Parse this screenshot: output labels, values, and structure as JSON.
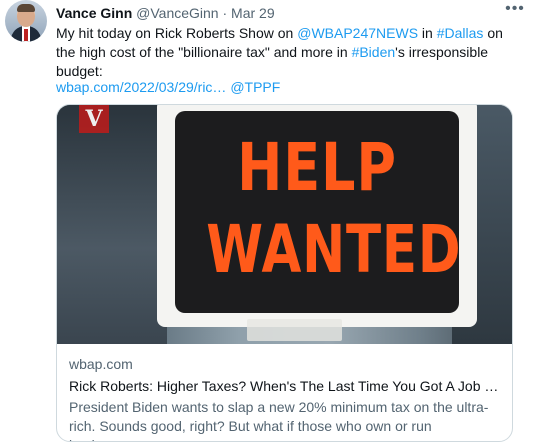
{
  "author": {
    "display_name": "Vance Ginn",
    "handle": "@VanceGinn",
    "separator": "·",
    "date": "Mar 29"
  },
  "more_icon": "ellipsis-icon",
  "tweet": {
    "text_1": "My hit today on Rick Roberts Show on ",
    "mention_1": "@WBAP247NEWS",
    "text_2": " in ",
    "hashtag_1": "#Dallas",
    "text_3": " on the high cost of the \"billionaire tax\" and more in ",
    "hashtag_2": "#Biden",
    "text_4": "'s irresponsible budget:",
    "url": "wbap.com/2022/03/29/ric…",
    "mention_2": "@TPPF"
  },
  "card": {
    "image_sign_line_1": "HELP",
    "image_sign_line_2": "WANTED",
    "image_logo": "V",
    "domain": "wbap.com",
    "title": "Rick Roberts: Higher Taxes? When's The Last Time You Got A Job Fro...",
    "description": "President Biden wants to slap a new 20% minimum tax on the ultra-rich. Sounds good, right? But what if those who own or run businesse..."
  }
}
